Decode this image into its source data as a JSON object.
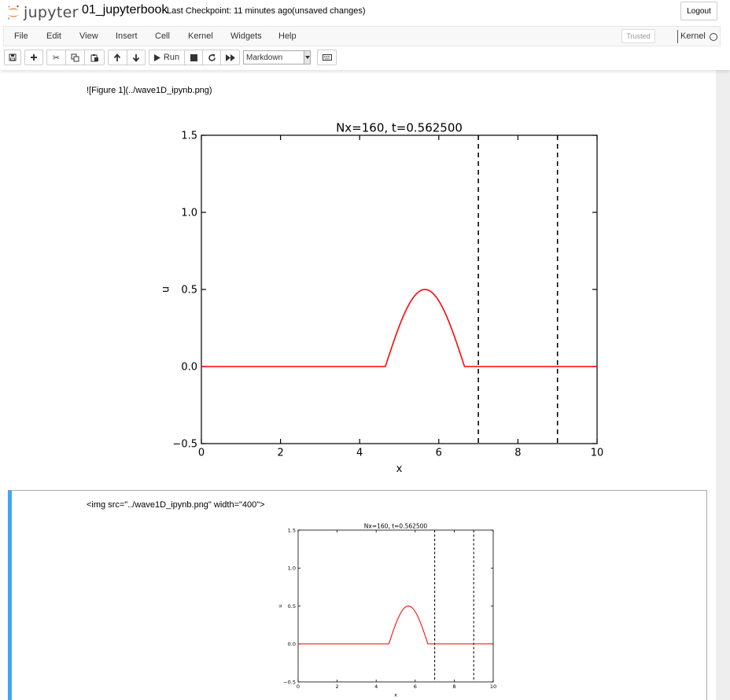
{
  "header": {
    "brand": "jupyter",
    "notebook_name": "01_jupyterbook",
    "checkpoint": "Last Checkpoint: 11 minutes ago",
    "unsaved": "(unsaved changes)",
    "logout_label": "Logout"
  },
  "menubar": {
    "items": [
      "File",
      "Edit",
      "View",
      "Insert",
      "Cell",
      "Kernel",
      "Widgets",
      "Help"
    ],
    "trusted": "Trusted",
    "kernel_label": "Kernel"
  },
  "toolbar": {
    "run_label": "Run",
    "cell_type": "Markdown",
    "icons": [
      "save-icon",
      "plus-icon",
      "cut-icon",
      "copy-icon",
      "paste-icon",
      "arrow-up-icon",
      "arrow-down-icon",
      "play-icon",
      "stop-icon",
      "restart-icon",
      "fast-forward-icon",
      "keyboard-icon"
    ]
  },
  "cells": [
    {
      "source": "![Figure 1](../wave1D_ipynb.png)"
    },
    {
      "source": "<img src=\"../wave1D_ipynb.png\" width=\"400\">"
    }
  ],
  "chart_data": [
    {
      "type": "line",
      "title": "Nx=160, t=0.562500",
      "xlabel": "x",
      "ylabel": "u",
      "xlim": [
        0,
        10
      ],
      "ylim": [
        -0.5,
        1.5
      ],
      "xticks": [
        "0",
        "2",
        "4",
        "6",
        "8",
        "10"
      ],
      "yticks": [
        "−0.5",
        "0.0",
        "0.5",
        "1.0",
        "1.5"
      ],
      "series": [
        {
          "color": "#ff0000",
          "x": [
            0,
            4.65,
            5.65,
            6.65,
            10
          ],
          "y": [
            0,
            0,
            0.5,
            0,
            0
          ],
          "shape": "sine-bump"
        }
      ],
      "vlines": {
        "x": [
          7,
          9
        ],
        "style": "dashed",
        "color": "#000000"
      },
      "grid": false
    },
    {
      "type": "line",
      "title": "Nx=160, t=0.562500",
      "xlabel": "x",
      "ylabel": "u",
      "xlim": [
        0,
        10
      ],
      "ylim": [
        -0.5,
        1.5
      ],
      "xticks": [
        "0",
        "2",
        "4",
        "6",
        "8",
        "10"
      ],
      "yticks": [
        "−0.5",
        "0.0",
        "0.5",
        "1.0",
        "1.5"
      ],
      "series": [
        {
          "color": "#ff0000",
          "x": [
            0,
            4.65,
            5.65,
            6.65,
            10
          ],
          "y": [
            0,
            0,
            0.5,
            0,
            0
          ],
          "shape": "sine-bump"
        }
      ],
      "vlines": {
        "x": [
          7,
          9
        ],
        "style": "dashed",
        "color": "#000000"
      },
      "grid": false
    }
  ]
}
